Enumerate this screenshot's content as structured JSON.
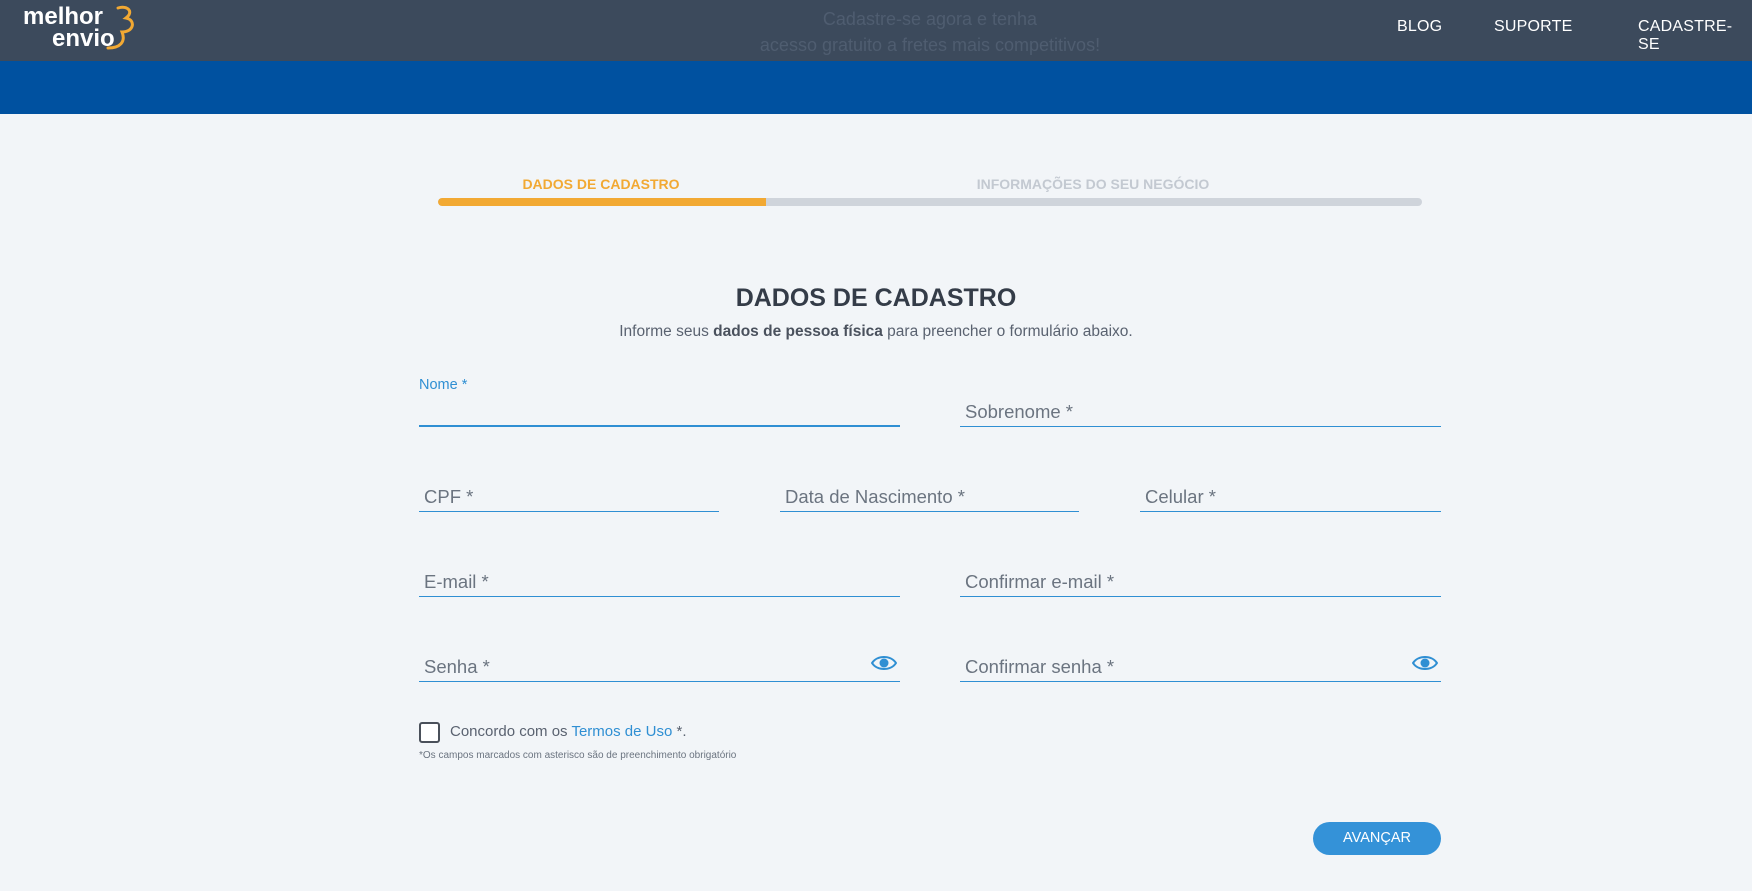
{
  "header": {
    "logo_line1": "melhor",
    "logo_line2": "envio",
    "promo_line1": "Cadastre-se agora e tenha",
    "promo_line2": "acesso gratuito a fretes mais competitivos!",
    "nav": [
      "BLOG",
      "SUPORTE",
      "CADASTRE-SE"
    ]
  },
  "stepper": {
    "steps": [
      "DADOS DE CADASTRO",
      "INFORMAÇÕES DO SEU NEGÓCIO"
    ],
    "active_step": 1,
    "progress_fraction": 0.333,
    "active_color": "#f2a933",
    "inactive_color": "#c3c9d1"
  },
  "form": {
    "title": "DADOS DE CADASTRO",
    "subtitle_pre": "Informe seus ",
    "subtitle_bold": "dados de pessoa física",
    "subtitle_post": " para preencher o formulário abaixo.",
    "fields": {
      "nome": "Nome *",
      "sobrenome": "Sobrenome *",
      "cpf": "CPF *",
      "nascimento": "Data de Nascimento *",
      "celular": "Celular *",
      "email": "E-mail *",
      "confirmar_email": "Confirmar e-mail *",
      "senha": "Senha *",
      "confirmar_senha": "Confirmar senha *"
    },
    "terms_pre": "Concordo com os ",
    "terms_link": "Termos de Uso",
    "terms_post": " *.",
    "footnote": "*Os campos marcados com asterisco são de preenchimento obrigatório",
    "submit": "AVANÇAR"
  },
  "colors": {
    "topbar": "#3c4a5c",
    "band": "#0051a0",
    "accent": "#3492d8",
    "logo_accent": "#f2a933"
  }
}
